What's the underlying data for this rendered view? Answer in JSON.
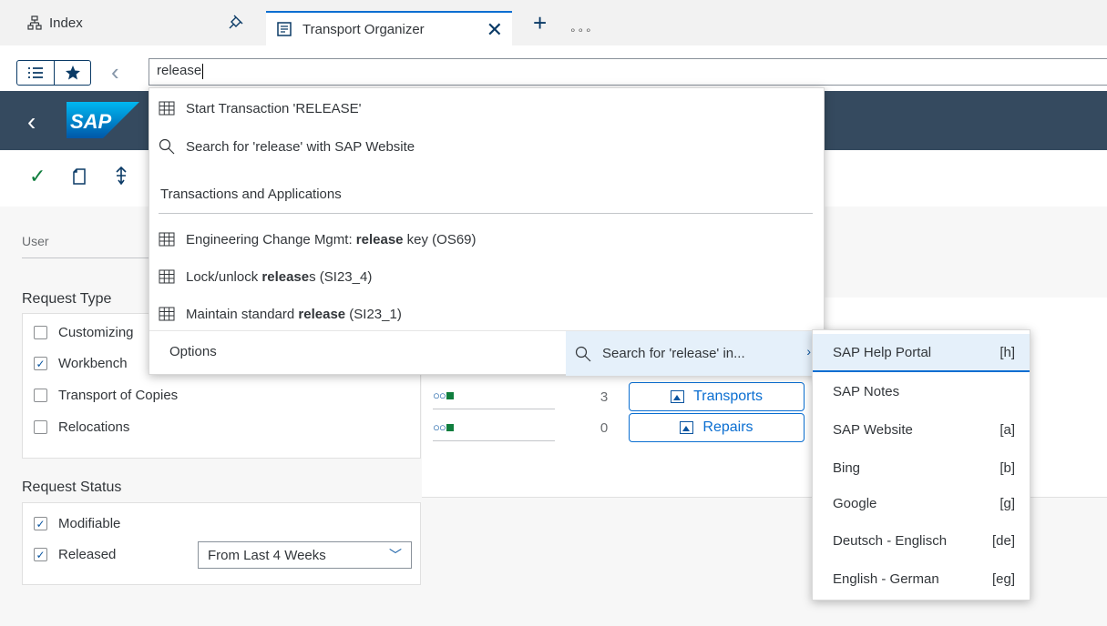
{
  "tabs": {
    "index_label": "Index",
    "active_label": "Transport Organizer",
    "close_glyph": "✕",
    "add_glyph": "+",
    "more_glyph": "∘∘∘"
  },
  "command": {
    "input_value": "release"
  },
  "dropdown": {
    "start_transaction": "Start Transaction 'RELEASE'",
    "search_website": "Search for 'release' with SAP Website",
    "group_label": "Transactions and Applications",
    "items": [
      {
        "pre": "Engineering Change Mgmt: ",
        "bold": "release",
        "post": " key (OS69)"
      },
      {
        "pre": "Lock/unlock ",
        "bold": "release",
        "post": "s (SI23_4)"
      },
      {
        "pre": "Maintain standard ",
        "bold": "release",
        "post": " (SI23_1)"
      }
    ],
    "options_label": "Options",
    "search_in_label": "Search for 'release' in..."
  },
  "submenu": {
    "items": [
      {
        "label": "SAP Help Portal",
        "key": "[h]"
      },
      {
        "label": "SAP Notes",
        "key": ""
      },
      {
        "label": "SAP Website",
        "key": "[a]"
      },
      {
        "label": "Bing",
        "key": "[b]"
      },
      {
        "label": "Google",
        "key": "[g]"
      },
      {
        "label": "Deutsch - Englisch",
        "key": "[de]"
      },
      {
        "label": "English - German",
        "key": "[eg]"
      }
    ]
  },
  "form": {
    "user_label": "User",
    "request_type_title": "Request Type",
    "request_types": [
      {
        "label": "Customizing",
        "checked": false
      },
      {
        "label": "Workbench",
        "checked": true
      },
      {
        "label": "Transport of Copies",
        "checked": false
      },
      {
        "label": "Relocations",
        "checked": false
      }
    ],
    "request_status_title": "Request Status",
    "statuses": [
      {
        "label": "Modifiable",
        "checked": true
      },
      {
        "label": "Released",
        "checked": true
      }
    ],
    "released_select_value": "From Last 4 Weeks"
  },
  "objects": {
    "rows": [
      {
        "count": "3",
        "button": "Transports"
      },
      {
        "count": "0",
        "button": "Repairs"
      }
    ]
  },
  "colors": {
    "shell_header": "#354a5f",
    "accent": "#0a6ed1",
    "positive": "#107e3e"
  }
}
